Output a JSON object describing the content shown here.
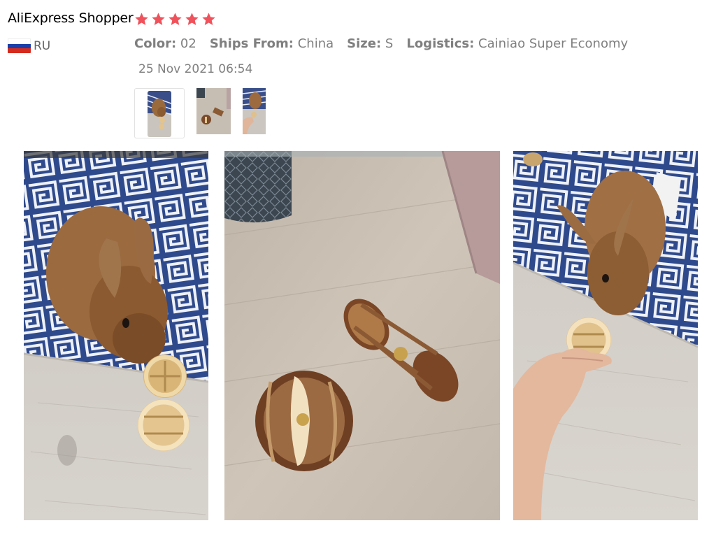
{
  "review": {
    "reviewer_name": "AliExpress Shopper",
    "rating": 5,
    "star_color": "#f0525b",
    "country": {
      "code": "RU",
      "flag_colors": [
        "#ffffff",
        "#1a3fa8",
        "#d52b1e"
      ]
    },
    "attributes": [
      {
        "label": "Color:",
        "value": "02"
      },
      {
        "label": "Ships From:",
        "value": "China"
      },
      {
        "label": "Size:",
        "value": "S"
      },
      {
        "label": "Logistics:",
        "value": "Cainiao Super Economy"
      }
    ],
    "date": "25 Nov 2021 06:54"
  },
  "thumbnails": [
    {
      "name": "rabbit-with-ball-toy",
      "selected": true
    },
    {
      "name": "wooden-toys-on-floor",
      "selected": false
    },
    {
      "name": "rabbit-with-ball-held-by-hand",
      "selected": false
    }
  ],
  "photos": [
    {
      "name": "rabbit-with-ball-toy"
    },
    {
      "name": "wooden-toys-on-floor"
    },
    {
      "name": "rabbit-with-ball-held-by-hand"
    }
  ]
}
